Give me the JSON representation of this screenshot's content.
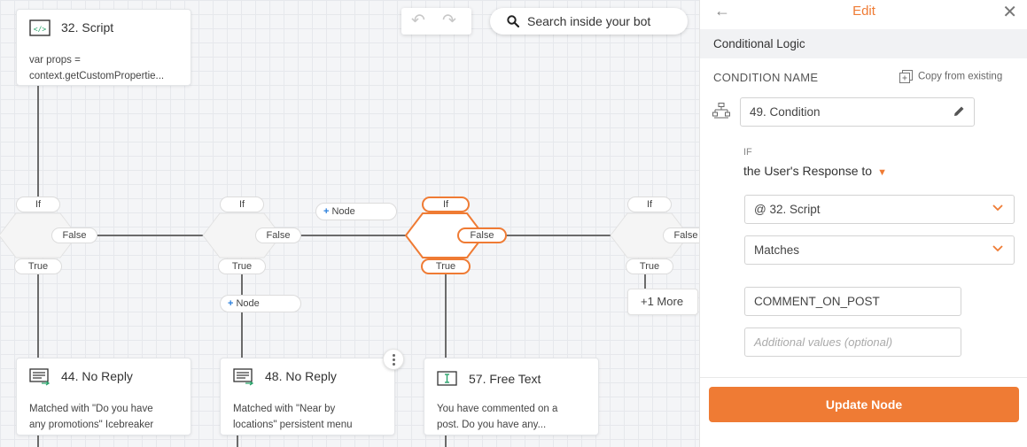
{
  "canvas": {
    "toolbar": {
      "undo_icon": "undo-icon",
      "redo_icon": "redo-icon"
    },
    "search": {
      "label": "Search inside your bot",
      "icon": "search-icon"
    },
    "nodes": {
      "script": {
        "title": "32. Script",
        "line1": "var props =",
        "line2": "context.getCustomPropertie..."
      },
      "no_reply_44": {
        "title": "44. No Reply",
        "line1": "Matched with \"Do you have",
        "line2": "any promotions\" Icebreaker"
      },
      "no_reply_48": {
        "title": "48. No Reply",
        "line1": "Matched with \"Near by",
        "line2": "locations\" persistent menu"
      },
      "free_text_57": {
        "title": "57. Free Text",
        "line1": "You have commented on a",
        "line2": "post. Do you have any..."
      }
    },
    "labels": {
      "if": "If",
      "false": "False",
      "true": "True",
      "node": "Node",
      "more": "+1 More"
    },
    "accent": "#ef7b34"
  },
  "panel": {
    "title": "Edit",
    "section": "Conditional Logic",
    "condition_name_label": "CONDITION NAME",
    "copy_link": "Copy from existing",
    "condition_name_value": "49. Condition",
    "if_label": "IF",
    "response_label": "the User's Response to",
    "source_select": "@ 32. Script",
    "operator_select": "Matches",
    "value_input": "COMMENT_ON_POST",
    "additional_placeholder": "Additional values (optional)",
    "update_button": "Update Node"
  }
}
